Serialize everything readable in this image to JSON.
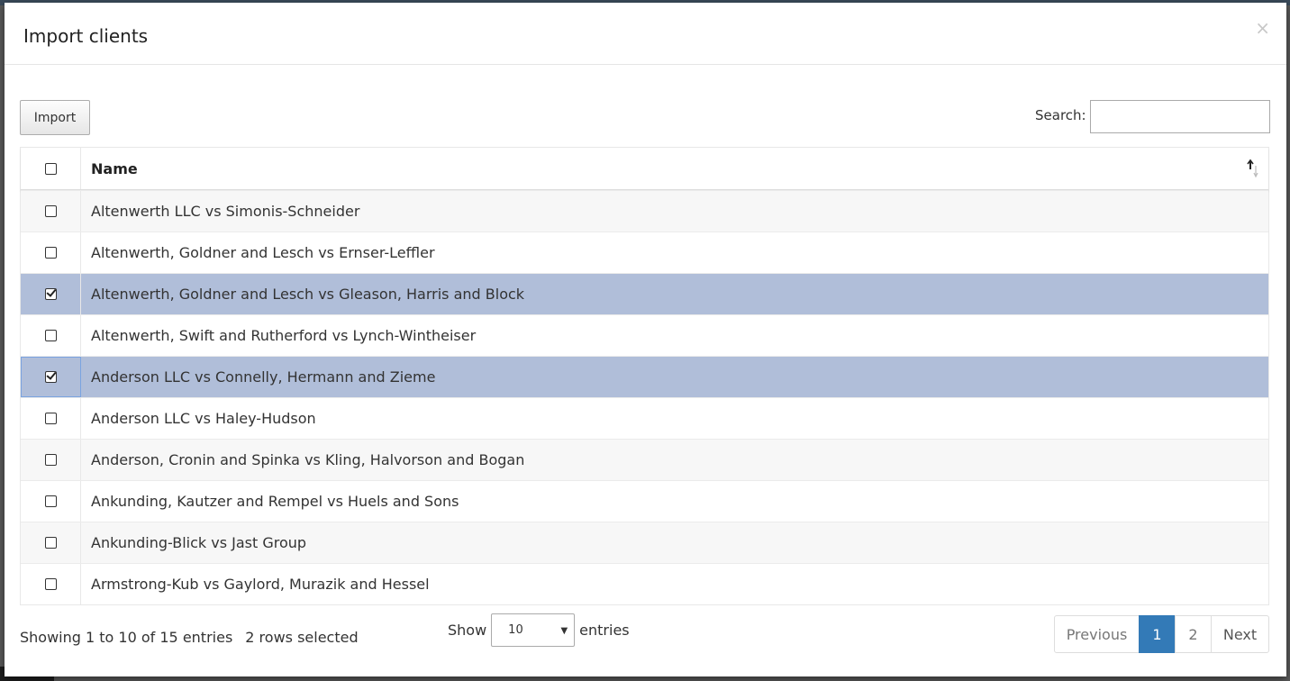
{
  "modal": {
    "title": "Import clients",
    "close_label": "×"
  },
  "toolbar": {
    "import_label": "Import",
    "search_label": "Search:",
    "search_value": ""
  },
  "table": {
    "header": {
      "name": "Name"
    },
    "rows": [
      {
        "name": "Altenwerth LLC vs Simonis-Schneider",
        "checked": false
      },
      {
        "name": "Altenwerth, Goldner and Lesch vs Ernser-Leffler",
        "checked": false
      },
      {
        "name": "Altenwerth, Goldner and Lesch vs Gleason, Harris and Block",
        "checked": true
      },
      {
        "name": "Altenwerth, Swift and Rutherford vs Lynch-Wintheiser",
        "checked": false
      },
      {
        "name": "Anderson LLC vs Connelly, Hermann and Zieme",
        "checked": true
      },
      {
        "name": "Anderson LLC vs Haley-Hudson",
        "checked": false
      },
      {
        "name": "Anderson, Cronin and Spinka vs Kling, Halvorson and Bogan",
        "checked": false
      },
      {
        "name": "Ankunding, Kautzer and Rempel vs Huels and Sons",
        "checked": false
      },
      {
        "name": "Ankunding-Blick vs Jast Group",
        "checked": false
      },
      {
        "name": "Armstrong-Kub vs Gaylord, Murazik and Hessel",
        "checked": false
      }
    ]
  },
  "footer": {
    "info": "Showing 1 to 10 of 15 entries",
    "selected": "2 rows selected",
    "show_label": "Show",
    "length_value": "10",
    "entries_label": "entries",
    "pagination": {
      "previous": "Previous",
      "page1": "1",
      "page2": "2",
      "next": "Next"
    }
  },
  "colors": {
    "selected_row": "#b0bed9",
    "active_page": "#337ab7"
  }
}
